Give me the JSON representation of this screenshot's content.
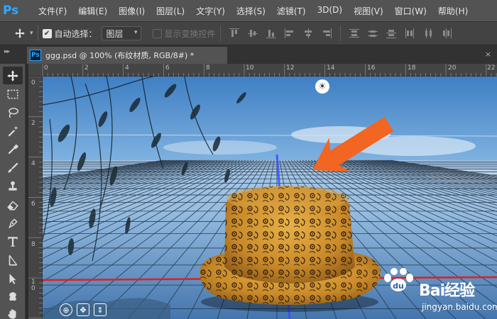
{
  "app": {
    "logo": "Ps"
  },
  "menubar": {
    "items": [
      "文件(F)",
      "编辑(E)",
      "图像(I)",
      "图层(L)",
      "文字(Y)",
      "选择(S)",
      "滤镜(T)",
      "3D(D)",
      "视图(V)",
      "窗口(W)",
      "帮助(H)"
    ]
  },
  "options": {
    "auto_select_label": "自动选择：",
    "auto_select_checked": true,
    "auto_select_target": "图层",
    "show_transform_label": "显示变换控件",
    "show_transform_checked": false
  },
  "document": {
    "tab_title": "ggg.psd @ 100% (布纹材质, RGB/8#) *"
  },
  "rulers": {
    "top_numbers": [
      "0",
      "2",
      "4",
      "6",
      "8",
      "10",
      "12",
      "14",
      "16",
      "18",
      "20",
      "22"
    ],
    "left_numbers": [
      "0",
      "2",
      "4",
      "6",
      "8",
      "1 0"
    ]
  },
  "watermark": {
    "brand": "Bai经验",
    "url": "jingyan.baidu.com"
  },
  "icons": {
    "move": "move-tool-icon",
    "marquee": "rectangular-marquee-icon",
    "lasso": "lasso-icon",
    "magic_wand": "quick-selection-icon",
    "eyedropper": "eyedropper-icon",
    "brush": "brush-icon",
    "stamp": "clone-stamp-icon",
    "eraser": "eraser-icon",
    "pen": "pen-icon",
    "type": "type-tool-icon",
    "path_select": "path-selection-icon",
    "direct": "direct-selection-icon",
    "hand": "hand-icon",
    "light": "light-widget-icon"
  },
  "colors": {
    "arrow": "#f26522",
    "ps_blue": "#31a8ff",
    "x_axis": "#e51d1d",
    "y_axis": "#3a4dff"
  }
}
